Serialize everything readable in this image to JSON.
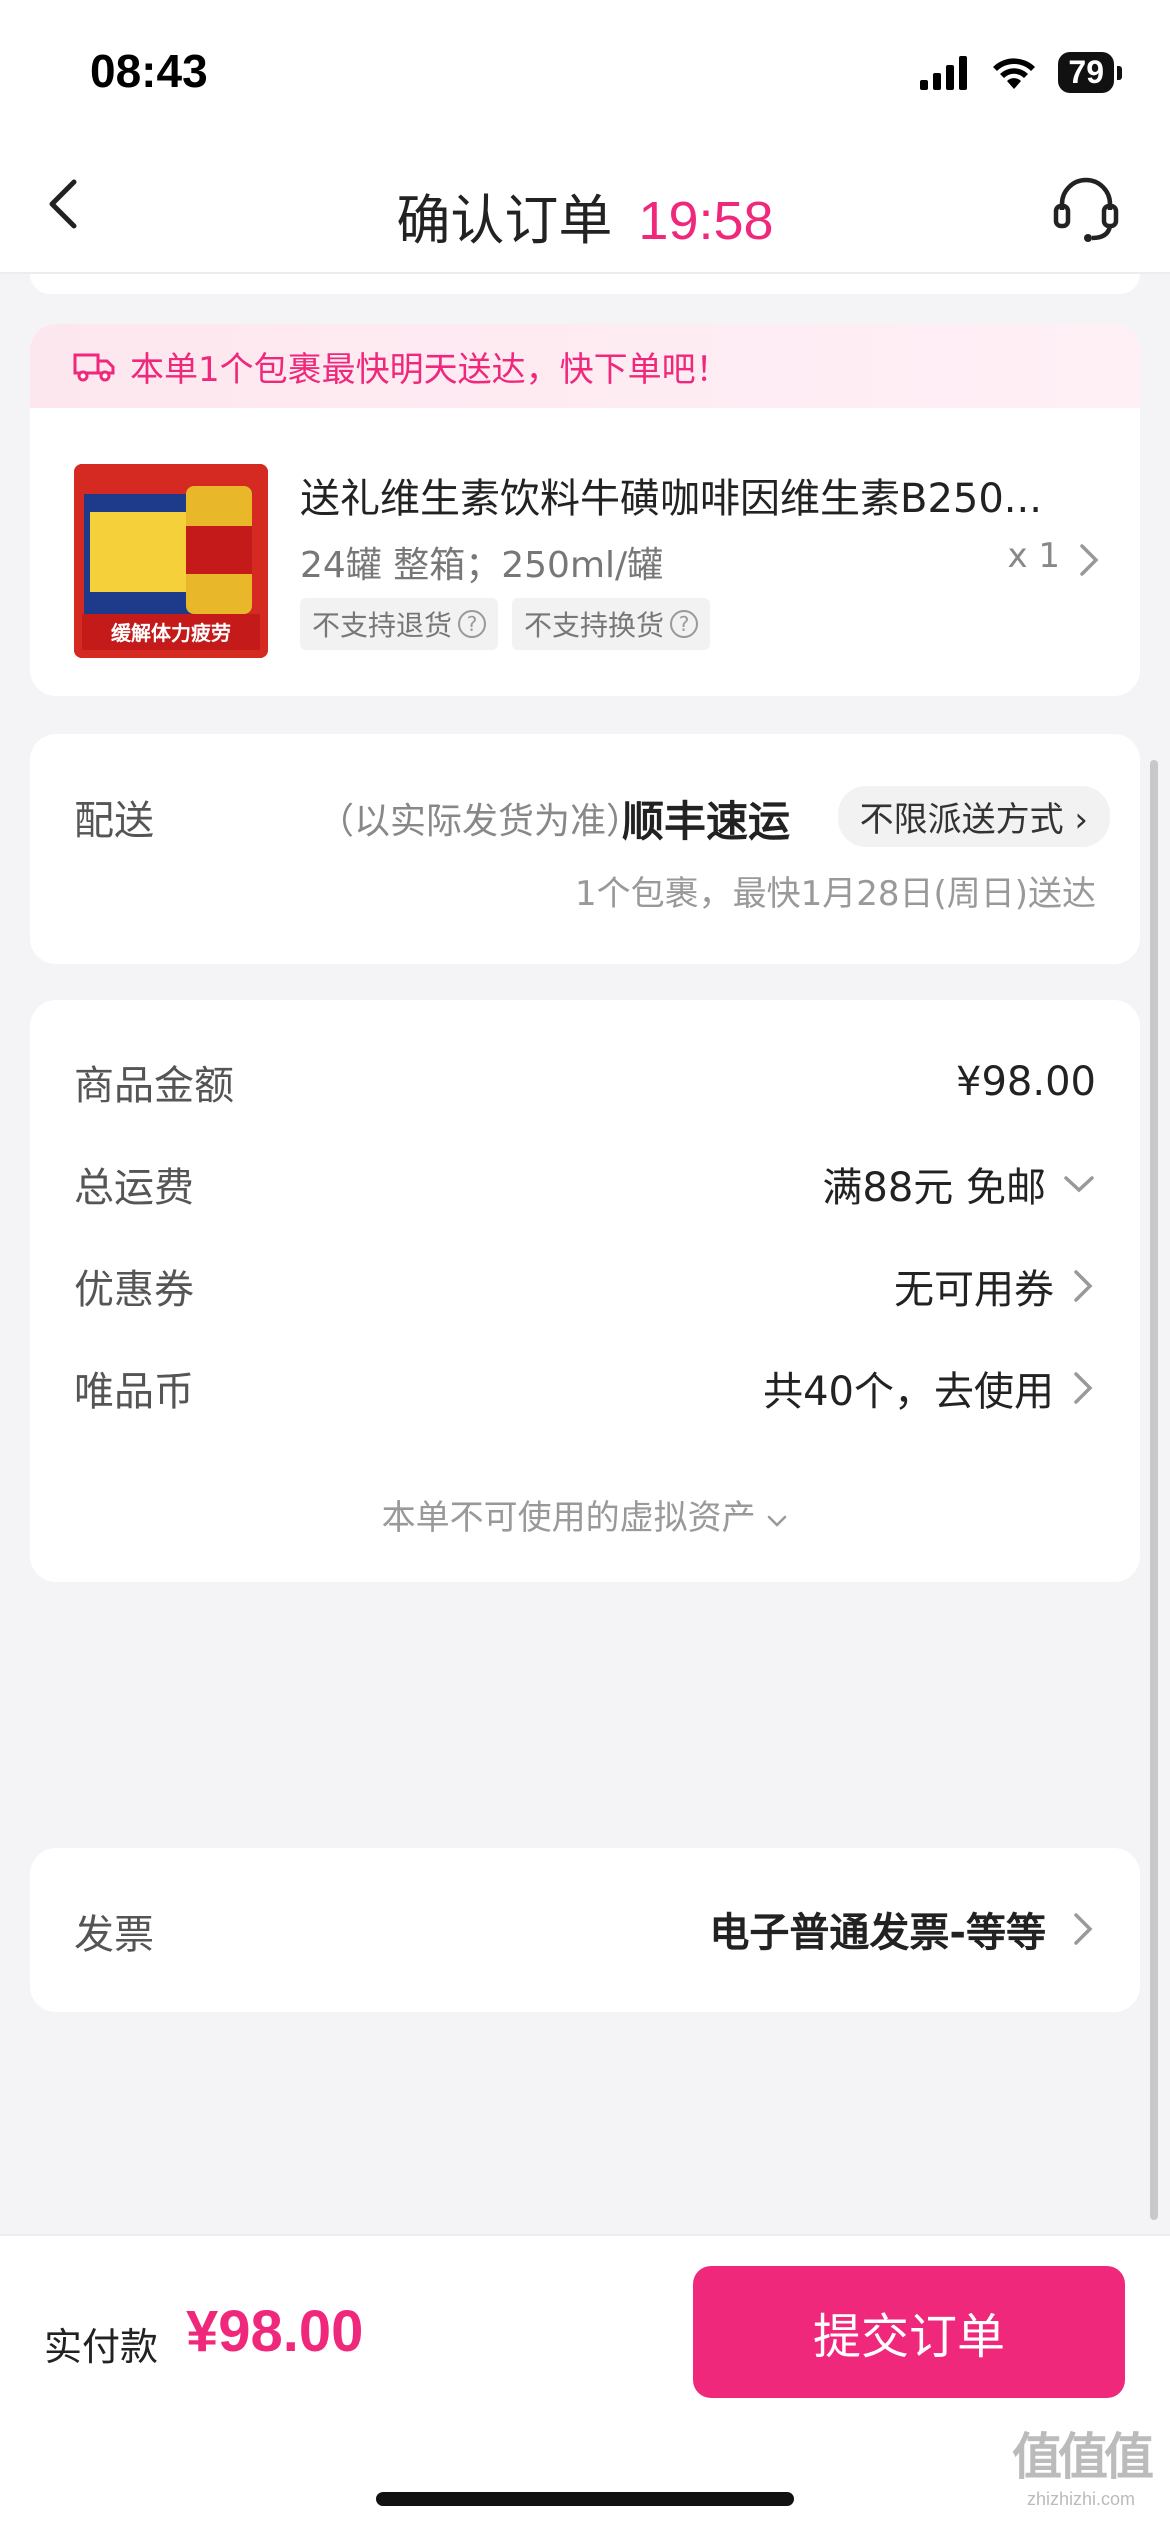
{
  "status_bar": {
    "time": "08:43",
    "battery": "79"
  },
  "nav": {
    "title": "确认订单",
    "countdown": "19:58"
  },
  "product_card": {
    "delivery_banner": "本单1个包裹最快明天送达，快下单吧！",
    "product": {
      "name": "送礼维生素饮料牛磺咖啡因维生素B250...",
      "spec": "24罐 整箱；250ml/罐",
      "quantity": "x 1",
      "image_caption": "缓解体力疲劳",
      "tags": [
        "不支持退货",
        "不支持换货"
      ]
    }
  },
  "shipping": {
    "label": "配送",
    "note": "（以实际发货为准）",
    "carrier": "顺丰速运",
    "method": "不限派送方式",
    "eta": "1个包裹，最快1月28日(周日)送达"
  },
  "fees": {
    "rows": [
      {
        "label": "商品金额",
        "value": "¥98.00"
      },
      {
        "label": "总运费",
        "value": "满88元 免邮"
      },
      {
        "label": "优惠券",
        "value": "无可用券"
      },
      {
        "label": "唯品币",
        "value": "共40个，去使用"
      }
    ],
    "virtual_assets": "本单不可使用的虚拟资产"
  },
  "invoice": {
    "label": "发票",
    "value": "电子普通发票-等等"
  },
  "bottom_bar": {
    "pay_label": "实付款",
    "pay_amount": "¥98.00",
    "submit_label": "提交订单"
  },
  "watermark": {
    "logo": "值值值",
    "url": "zhizhizhi.com"
  },
  "colors": {
    "accent": "#f0287b",
    "banner_bg": "#fde7ef",
    "page_bg": "#f4f4f6"
  }
}
